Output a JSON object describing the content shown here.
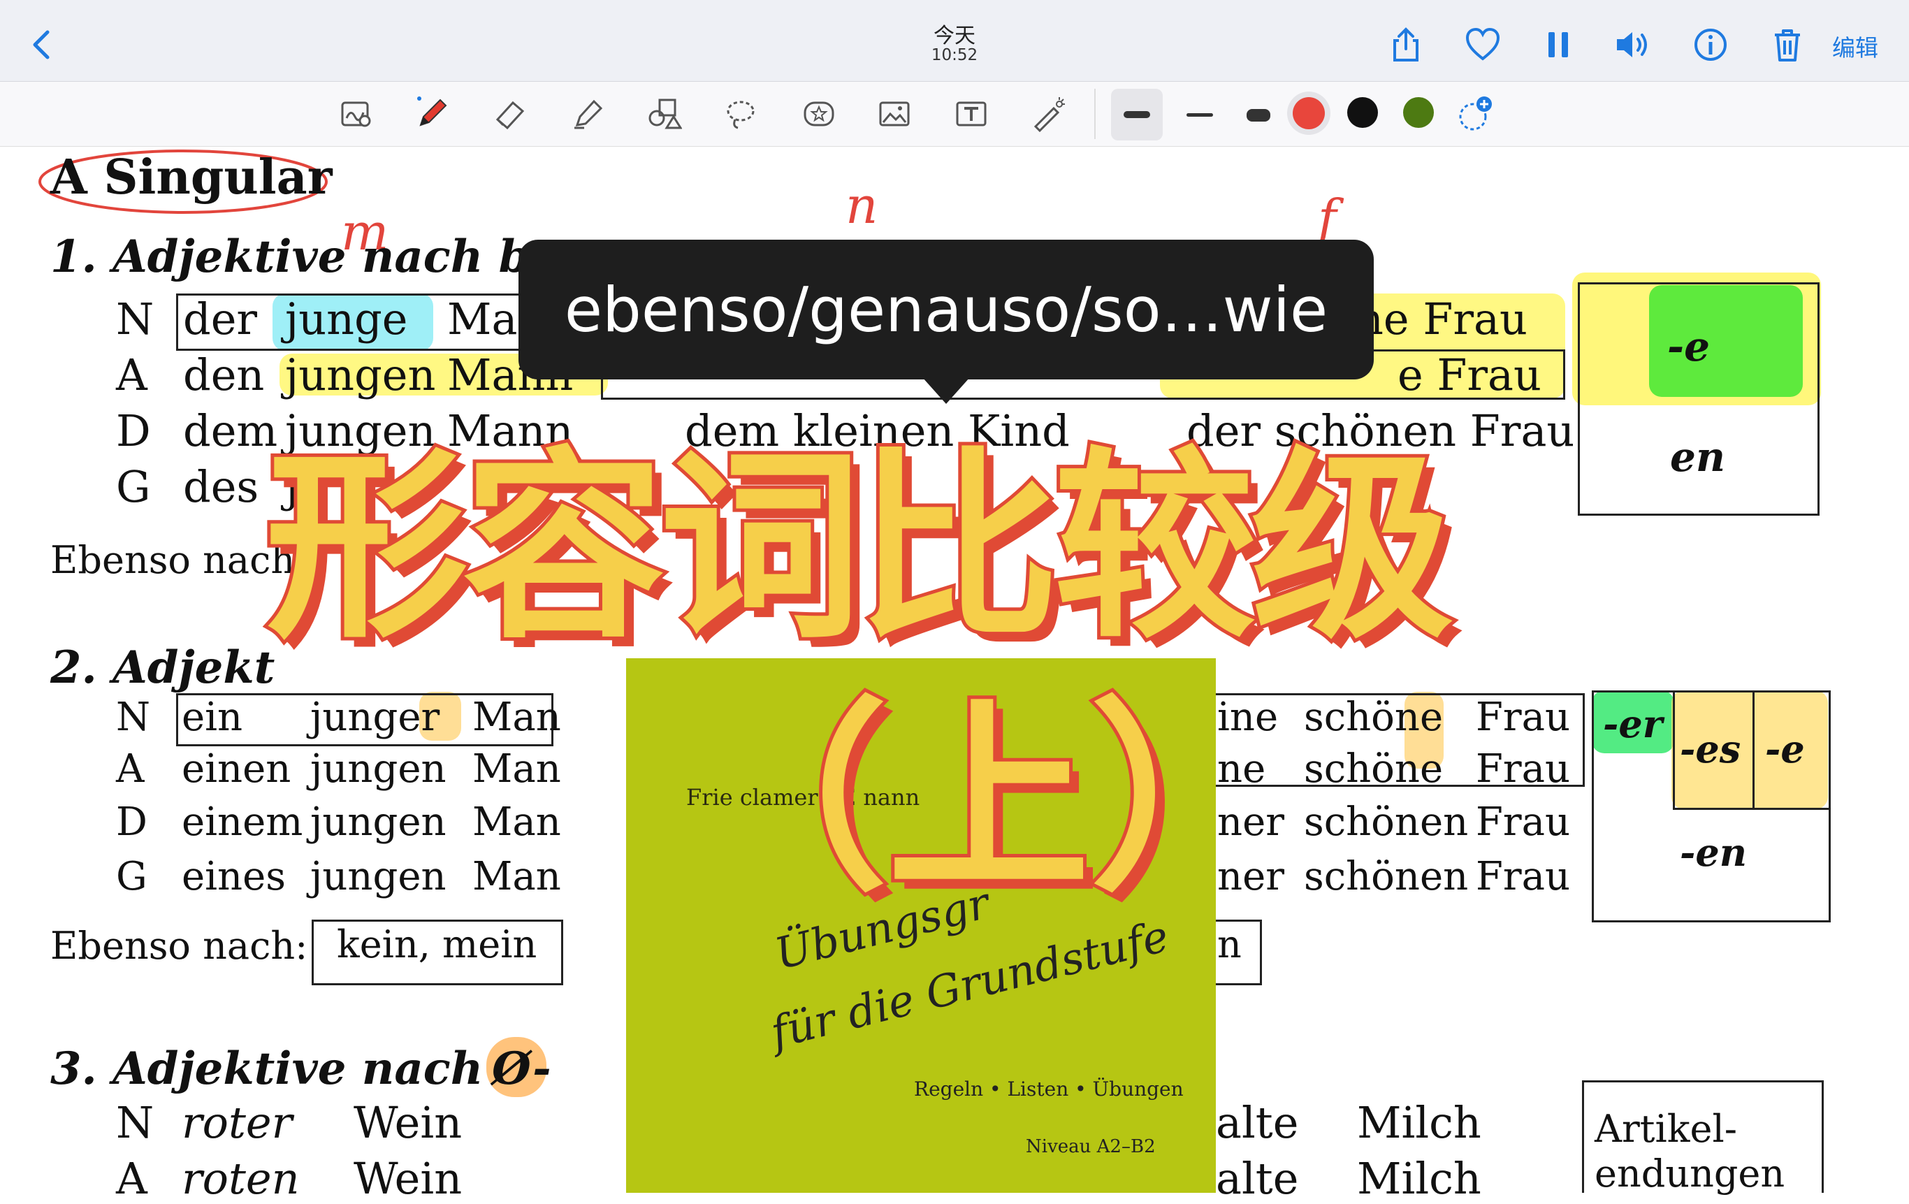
{
  "header": {
    "back_icon": "chevron-left-icon",
    "date_label": "今天",
    "time_label": "10:52",
    "actions": [
      "share-icon",
      "heart-icon",
      "pause-icon",
      "speaker-icon",
      "info-icon",
      "trash-icon"
    ],
    "edit_label": "编辑"
  },
  "toolbar": {
    "tools": [
      "search-note-icon",
      "pen-icon",
      "eraser-icon",
      "highlighter-icon",
      "shapes-icon",
      "lasso-icon",
      "sticker-icon",
      "image-icon",
      "text-box-icon",
      "laser-pointer-icon"
    ],
    "colors": {
      "red": "#e8463c",
      "black": "#111111",
      "green": "#4d7a12"
    }
  },
  "doc": {
    "section_title": "A  Singular",
    "s1_title": "1.  Adjektive nach b",
    "s1_rows": {
      "N": {
        "case": "N",
        "art": "der",
        "adj": "junge",
        "noun": "Ma",
        "right": "ne   Frau"
      },
      "A": {
        "case": "A",
        "art": "den",
        "adj": "jungen",
        "noun": "Mann",
        "right": "e   Frau"
      },
      "D": {
        "case": "D",
        "art": "dem",
        "adj": "jungen",
        "noun": "Mann",
        "mid": "dem kleinen  Kind",
        "right": "der schönen Frau"
      },
      "G": {
        "case": "G",
        "art": "des",
        "adj": "j"
      }
    },
    "s1_endings": {
      "e": "-e",
      "en": "en"
    },
    "ebenso1": "Ebenso nach",
    "s2_title": "2.  Adjekt",
    "s2_rows": {
      "N": {
        "case": "N",
        "art": "ein",
        "adj": "junger",
        "noun": "Man",
        "right1": "ine",
        "right2": "schöne",
        "right3": "Frau"
      },
      "A": {
        "case": "A",
        "art": "einen",
        "adj": "jungen",
        "noun": "Man",
        "right1": "ne",
        "right2": "schöne",
        "right3": "Frau"
      },
      "D": {
        "case": "D",
        "art": "einem",
        "adj": "jungen",
        "noun": "Man",
        "right1": "ner",
        "right2": "schönen",
        "right3": "Frau"
      },
      "G": {
        "case": "G",
        "art": "eines",
        "adj": "jungen",
        "noun": "Man",
        "right1": "ner",
        "right2": "schönen",
        "right3": "Frau"
      }
    },
    "s2_endings": {
      "er": "-er",
      "es": "-es",
      "e": "-e",
      "en": "-en"
    },
    "ebenso2": "Ebenso nach:",
    "ebenso2_box": "kein, mein",
    "ebenso2_right": "n",
    "s3_title": "3.  Adjektive nach",
    "s3_symbol": "Ø-",
    "s3_rows": {
      "N": {
        "case": "N",
        "adj": "roter",
        "noun": "Wein",
        "right": "alte",
        "right2": "Milch"
      },
      "A": {
        "case": "A",
        "adj": "roten",
        "noun": "Wein",
        "right": "alte",
        "right2": "Milch"
      }
    },
    "artikel_box": {
      "line1": "Artikel-",
      "line2": "endungen"
    },
    "handwritten": {
      "m": "m",
      "n": "n",
      "f": "f"
    }
  },
  "tooltip": {
    "text": "ebenso/genauso/so…wie"
  },
  "book": {
    "authors": "Frie   clamer / E          nann",
    "title1": "Übungsgr",
    "title2": "für die Grundstufe",
    "subtitle": "Regeln • Listen • Übungen",
    "level": "Niveau A2–B2"
  },
  "overlay_title": {
    "line1": "形容词比较级",
    "line2": "（上）"
  }
}
